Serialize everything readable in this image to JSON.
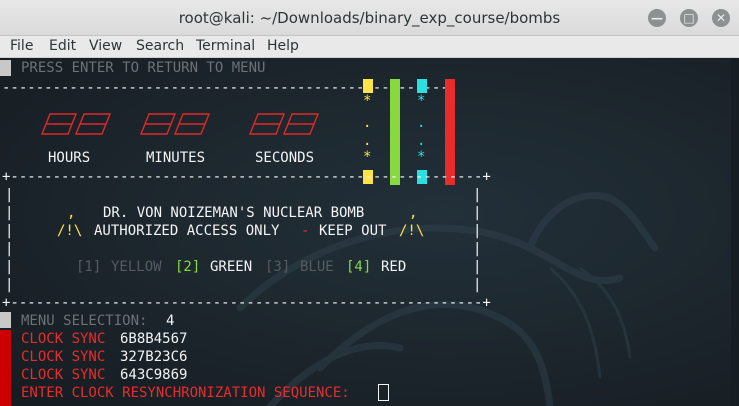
{
  "window": {
    "title": "root@kali: ~/Downloads/binary_exp_course/bombs",
    "minimize_glyph": "—",
    "maximize_glyph": "□",
    "close_glyph": "✕"
  },
  "menubar": [
    "File",
    "Edit",
    "View",
    "Search",
    "Terminal",
    "Help"
  ],
  "terminal": {
    "header": "PRESS ENTER TO RETURN TO MENU",
    "dash_line": "------------------------------------------------------",
    "timer_labels": {
      "hours": "HOURS",
      "minutes": "MINUTES",
      "seconds": "SECONDS"
    },
    "wire_marks": {
      "star": "*",
      "dot": "."
    },
    "box": {
      "top": "+--------------------------------------------------------+",
      "bottom": "+--------------------------------------------------------+",
      "side": "|",
      "comma": ",",
      "title": "DR. VON NOIZEMAN'S NUCLEAR BOMB",
      "warn_sign": "/!\\",
      "warn_left": "AUTHORIZED ACCESS ONLY",
      "warn_sep": "-",
      "warn_right": "KEEP OUT",
      "options": [
        {
          "num": "[1]",
          "label": "YELLOW"
        },
        {
          "num": "[2]",
          "label": "GREEN"
        },
        {
          "num": "[3]",
          "label": "BLUE"
        },
        {
          "num": "[4]",
          "label": "RED"
        }
      ]
    },
    "menu_selection_label": "MENU SELECTION:",
    "menu_selection_value": "4",
    "clock_syncs": [
      {
        "label": "CLOCK SYNC",
        "value": "6B8B4567"
      },
      {
        "label": "CLOCK SYNC",
        "value": "327B23C6"
      },
      {
        "label": "CLOCK SYNC",
        "value": "643C9869"
      }
    ],
    "prompt": "ENTER CLOCK RESYNCHRONIZATION SEQUENCE:"
  },
  "colors": {
    "yellow_wire": "#ffe347",
    "green_wire": "#88d840",
    "blue_wire": "#2ae0e0",
    "red_wire": "#e82c2c"
  }
}
